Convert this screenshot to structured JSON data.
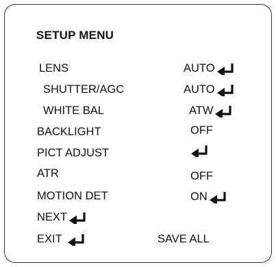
{
  "menu": {
    "title": "SETUP MENU",
    "items": [
      {
        "label": "LENS",
        "value": "AUTO",
        "enter": true
      },
      {
        "label": "SHUTTER/AGC",
        "value": "AUTO",
        "enter": true
      },
      {
        "label": "WHITE BAL",
        "value": "ATW",
        "enter": true
      },
      {
        "label": "BACKLIGHT",
        "value": "OFF",
        "enter": false
      },
      {
        "label": "PICT ADJUST",
        "value": "",
        "enter": true
      },
      {
        "label": "ATR",
        "value": "OFF",
        "enter": false
      },
      {
        "label": "MOTION DET",
        "value": "ON",
        "enter": true
      }
    ],
    "next_label": "NEXT",
    "exit_label": "EXIT",
    "save_label": "SAVE ALL"
  },
  "icons": {
    "enter": "enter-return-arrow-icon"
  },
  "colors": {
    "text": "#111111",
    "border": "#333333",
    "background": "#ffffff"
  }
}
